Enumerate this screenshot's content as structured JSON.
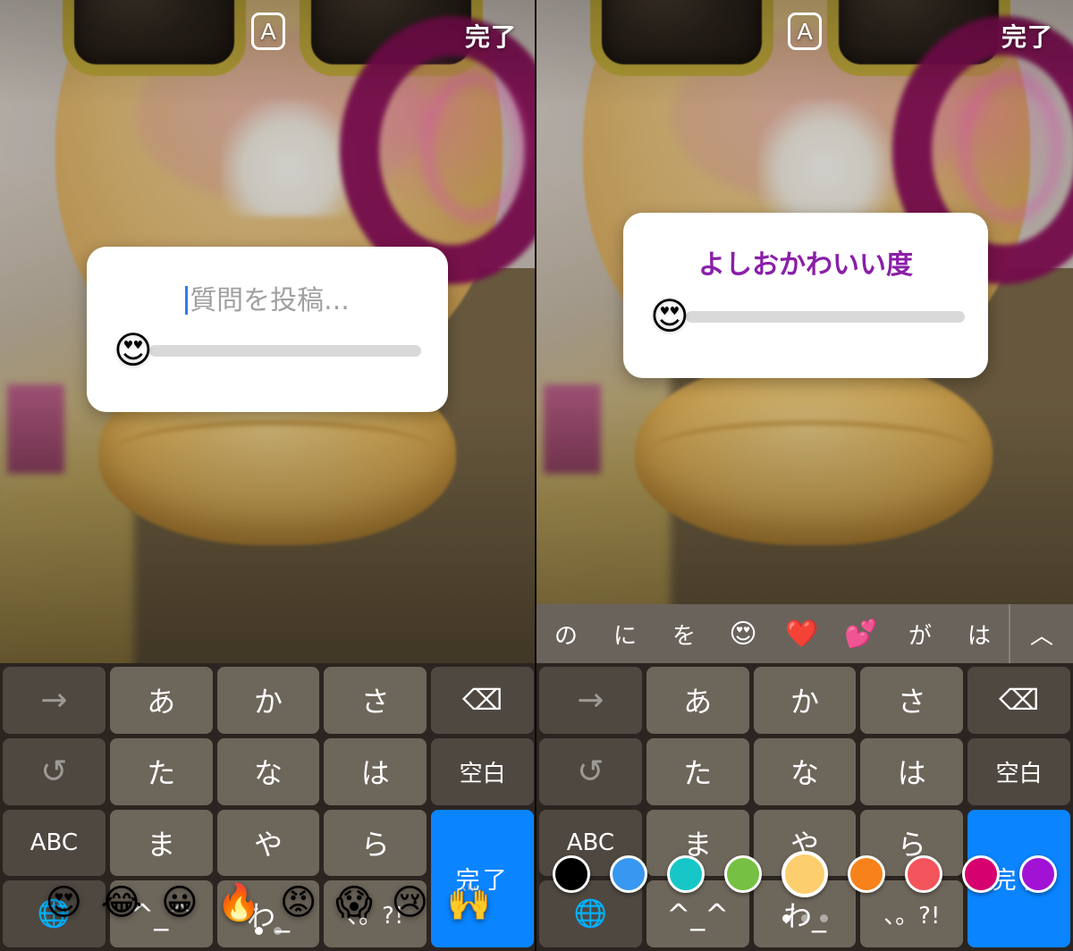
{
  "meta": {
    "app": "Instagram Stories question sticker editor",
    "panels": [
      "left",
      "right"
    ]
  },
  "topbar": {
    "text_style_label": "A",
    "done_label": "完了"
  },
  "left_panel": {
    "card": {
      "placeholder": "質問を投稿...",
      "has_caret": true,
      "slider_emoji": "😍",
      "slider_value": 0
    },
    "emoji_tray": {
      "emojis": [
        "😍",
        "😂",
        "😀",
        "🔥",
        "😡",
        "😱",
        "😢",
        "🙌"
      ],
      "page_dots": 2,
      "active_dot": 0
    }
  },
  "right_panel": {
    "card": {
      "title": "よしおかわいい度",
      "title_color": "#8a1fa8",
      "slider_emoji": "😍",
      "slider_value": 0
    },
    "color_tray": {
      "colors": [
        {
          "name": "black",
          "hex": "#000000",
          "selected": false
        },
        {
          "name": "blue",
          "hex": "#3897f0",
          "selected": false
        },
        {
          "name": "cyan",
          "hex": "#17c7c7",
          "selected": false
        },
        {
          "name": "green",
          "hex": "#76c043",
          "selected": false
        },
        {
          "name": "yellow",
          "hex": "#fdce6d",
          "selected": true
        },
        {
          "name": "orange",
          "hex": "#f7821b",
          "selected": false
        },
        {
          "name": "red",
          "hex": "#f3545b",
          "selected": false
        },
        {
          "name": "magenta",
          "hex": "#d6006f",
          "selected": false
        },
        {
          "name": "purple",
          "hex": "#a112d4",
          "selected": false
        }
      ],
      "page_dots": 3,
      "active_dot": 0
    },
    "predictive_bar": {
      "items": [
        "の",
        "に",
        "を",
        "😍",
        "❤️",
        "💕",
        "が",
        "は"
      ],
      "collapse_icon": "︿"
    }
  },
  "keyboard": {
    "rows": [
      [
        {
          "label": "→",
          "kind": "fn-dim",
          "name": "cursor-right-key"
        },
        {
          "label": "あ",
          "kind": "char",
          "name": "kana-a-key"
        },
        {
          "label": "か",
          "kind": "char",
          "name": "kana-ka-key"
        },
        {
          "label": "さ",
          "kind": "char",
          "name": "kana-sa-key"
        },
        {
          "label": "⌫",
          "kind": "fn",
          "name": "backspace-key"
        }
      ],
      [
        {
          "label": "↺",
          "kind": "fn-dim",
          "name": "undo-key"
        },
        {
          "label": "た",
          "kind": "char",
          "name": "kana-ta-key"
        },
        {
          "label": "な",
          "kind": "char",
          "name": "kana-na-key"
        },
        {
          "label": "は",
          "kind": "char",
          "name": "kana-ha-key"
        },
        {
          "label": "空白",
          "kind": "fn-lbl",
          "name": "space-key"
        }
      ],
      [
        {
          "label": "ABC",
          "kind": "fn-lbl",
          "name": "abc-switch-key"
        },
        {
          "label": "ま",
          "kind": "char",
          "name": "kana-ma-key"
        },
        {
          "label": "や",
          "kind": "char",
          "name": "kana-ya-key"
        },
        {
          "label": "ら",
          "kind": "char",
          "name": "kana-ra-key"
        },
        {
          "label": "完了",
          "kind": "blue",
          "name": "done-key"
        }
      ],
      [
        {
          "label": "🌐",
          "kind": "fn-globe",
          "name": "globe-key"
        },
        {
          "label": "^_^",
          "kind": "char",
          "name": "kaomoji-key"
        },
        {
          "label": "わ_",
          "kind": "char",
          "name": "kana-wa-key"
        },
        {
          "label": "、。?!",
          "kind": "punc",
          "name": "punctuation-key"
        }
      ]
    ]
  }
}
